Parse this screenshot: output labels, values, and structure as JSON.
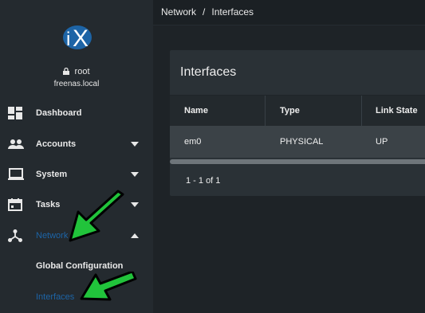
{
  "user": {
    "name": "root",
    "host": "freenas.local"
  },
  "nav": {
    "dashboard": "Dashboard",
    "accounts": "Accounts",
    "system": "System",
    "tasks": "Tasks",
    "network": "Network",
    "network_sub": {
      "global_configuration": "Global Configuration",
      "interfaces": "Interfaces"
    }
  },
  "breadcrumb": {
    "section": "Network",
    "separator": "/",
    "page": "Interfaces"
  },
  "card": {
    "title": "Interfaces",
    "columns": [
      "Name",
      "Type",
      "Link State"
    ],
    "rows": [
      {
        "name": "em0",
        "type": "PHYSICAL",
        "link_state": "UP"
      }
    ],
    "paginator": "1 - 1 of 1"
  },
  "colors": {
    "accent": "#1d64a6",
    "arrow": "#21c33b",
    "sidebar": "#242a2f"
  }
}
